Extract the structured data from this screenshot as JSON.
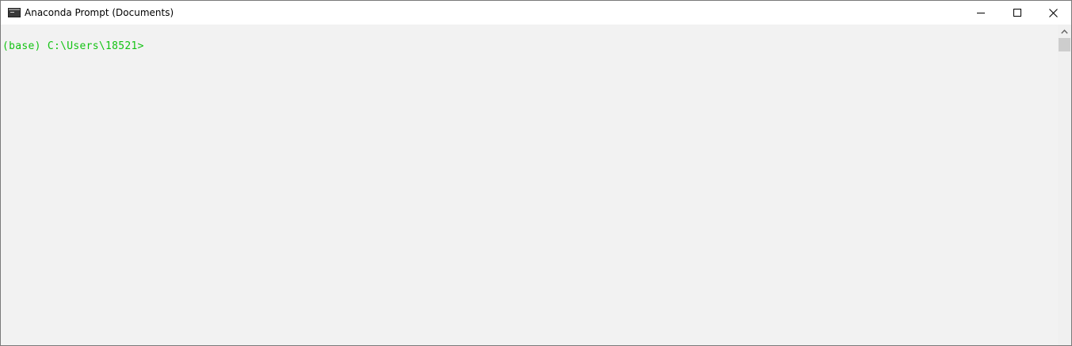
{
  "window": {
    "title": "Anaconda Prompt (Documents)",
    "icon": "terminal-icon"
  },
  "caption_buttons": {
    "minimize": "minimize-icon",
    "maximize": "maximize-icon",
    "close": "close-icon"
  },
  "console": {
    "prompt": "(base) C:\\Users\\18521>",
    "text_color": "#13c313",
    "background": "#f2f2f2"
  },
  "scrollbar": {
    "up_arrow": "chevron-up-icon"
  }
}
